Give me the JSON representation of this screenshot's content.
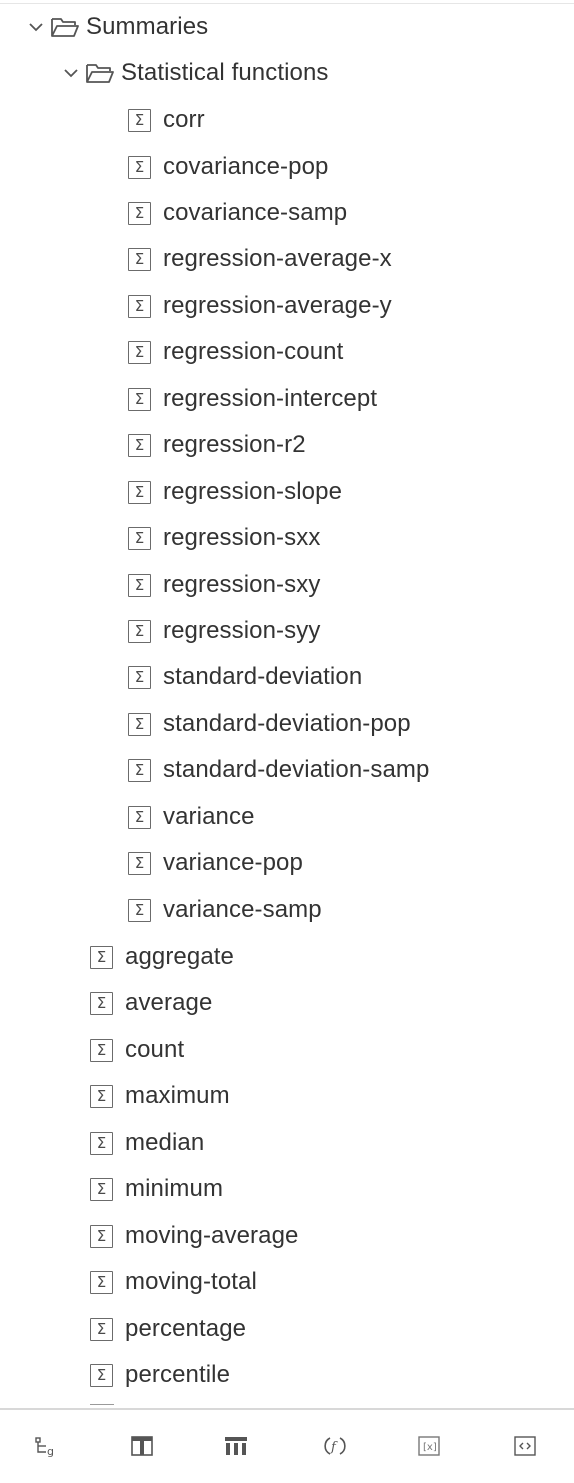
{
  "tree": {
    "summaries": {
      "label": "Summaries",
      "icon": "folder-open-icon",
      "expanded": true
    },
    "statistical": {
      "label": "Statistical functions",
      "icon": "folder-open-icon",
      "expanded": true
    },
    "sigma_symbol": "Σ",
    "statistical_items": [
      "corr",
      "covariance-pop",
      "covariance-samp",
      "regression-average-x",
      "regression-average-y",
      "regression-count",
      "regression-intercept",
      "regression-r2",
      "regression-slope",
      "regression-sxx",
      "regression-sxy",
      "regression-syy",
      "standard-deviation",
      "standard-deviation-pop",
      "standard-deviation-samp",
      "variance",
      "variance-pop",
      "variance-samp"
    ],
    "summary_items": [
      "aggregate",
      "average",
      "count",
      "maximum",
      "median",
      "minimum",
      "moving-average",
      "moving-total",
      "percentage",
      "percentile"
    ]
  },
  "toolbar": {
    "buttons": [
      {
        "name": "source-tree-icon"
      },
      {
        "name": "data-item-icon"
      },
      {
        "name": "table-columns-icon"
      },
      {
        "name": "function-icon"
      },
      {
        "name": "parameter-icon"
      },
      {
        "name": "macro-icon"
      }
    ]
  },
  "colors": {
    "text": "#333333",
    "icon": "#6b6b6b",
    "divider": "#d8d8d8"
  }
}
